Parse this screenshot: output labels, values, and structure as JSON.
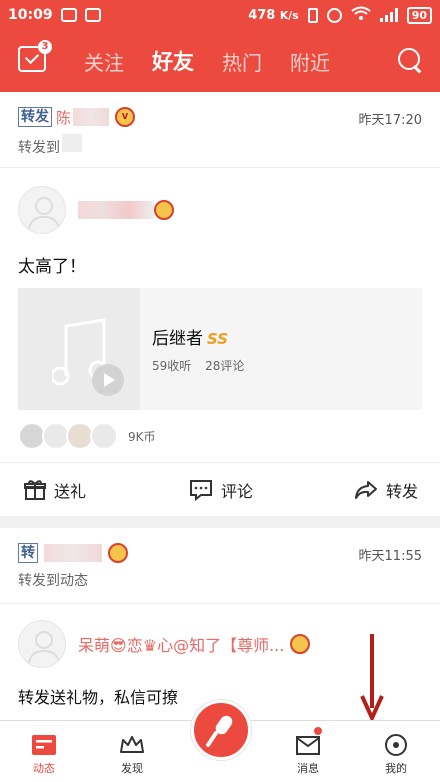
{
  "status": {
    "time": "10:09",
    "net_speed": "478",
    "net_unit": "K/s",
    "battery": "90"
  },
  "header": {
    "checkin_badge": "3",
    "tabs": [
      {
        "label": "关注",
        "active": false
      },
      {
        "label": "好友",
        "active": true
      },
      {
        "label": "热门",
        "active": false
      },
      {
        "label": "附近",
        "active": false
      }
    ]
  },
  "feed": {
    "item1": {
      "tag": "转发",
      "user": "陈",
      "time": "昨天17:20",
      "repost_text": "转发到",
      "post_text": "太高了！",
      "song_title": "后继者",
      "song_badge": "SS",
      "listens": "59收听",
      "comments": "28评论",
      "coins": "9K币",
      "actions": {
        "gift": "送礼",
        "comment": "评论",
        "share": "转发"
      }
    },
    "item2": {
      "tag": "转",
      "time": "昨天11:55",
      "repost_text": "转发到动态",
      "user": "呆萌",
      "user_mid": "恋",
      "user_tail": "心@知了【尊师...",
      "post_text": "转发送礼物，私信可撩"
    }
  },
  "bottom_nav": {
    "items": [
      {
        "label": "动态",
        "icon": "feed-icon",
        "active": true
      },
      {
        "label": "发现",
        "icon": "crown-icon",
        "active": false
      },
      {
        "label": "",
        "icon": "mic-icon",
        "active": false
      },
      {
        "label": "消息",
        "icon": "message-icon",
        "active": false
      },
      {
        "label": "我的",
        "icon": "profile-icon",
        "active": false
      }
    ]
  },
  "colors": {
    "accent": "#ed4a3f",
    "link_name": "#e76a64",
    "tag_blue": "#3f5f8f"
  }
}
